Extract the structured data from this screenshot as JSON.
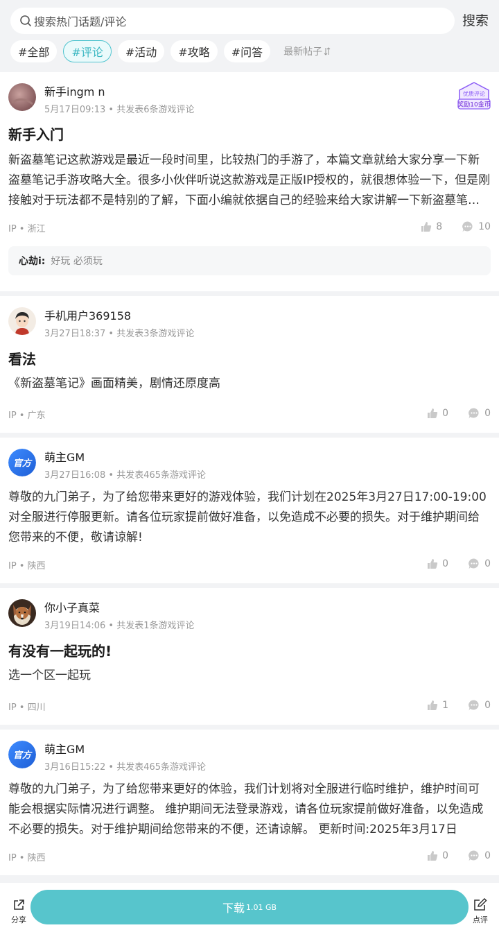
{
  "search": {
    "placeholder": "搜索热门话题/评论",
    "button": "搜索"
  },
  "tabs": [
    {
      "label": "#全部",
      "active": false
    },
    {
      "label": "#评论",
      "active": true
    },
    {
      "label": "#活动",
      "active": false
    },
    {
      "label": "#攻略",
      "active": false
    },
    {
      "label": "#问答",
      "active": false
    }
  ],
  "sort": {
    "label": "最新帖子"
  },
  "colors": {
    "accent": "#57c5cc",
    "tab_active": "#3ab7c2",
    "badge": "#8b5cf6",
    "official": "#2f6fe8"
  },
  "posts": [
    {
      "user": "新手ingm n",
      "avatar": "photo-avatar-pink",
      "date": "5月17日09:13",
      "count": "共发表6条游戏评论",
      "badge": {
        "line1": "优质评论",
        "line2": "奖励10金币"
      },
      "title": "新手入门",
      "body": "新盗墓笔记这款游戏是最近一段时间里，比较热门的手游了，本篇文章就给大家分享一下新盗墓笔记手游攻略大全。很多小伙伴听说这款游戏是正版IP授权的，就很想体验一下，但是刚接触对于玩法都不是特别的了解，下面小编就依据自己的经验来给大家讲解一下新盗墓笔记手游的玩法技巧。",
      "ip": "IP • 浙江",
      "likes": "8",
      "comments": "10",
      "reply": {
        "name": "心劫i:",
        "text": "好玩 必须玩"
      }
    },
    {
      "user": "手机用户369158",
      "avatar": "cartoon-avatar-boy",
      "date": "3月27日18:37",
      "count": "共发表3条游戏评论",
      "title": "看法",
      "body": "《新盗墓笔记》画面精美，剧情还原度高",
      "ip": "IP • 广东",
      "likes": "0",
      "comments": "0"
    },
    {
      "user": "萌主GM",
      "avatar": "official-avatar",
      "avatar_text": "官方",
      "date": "3月27日16:08",
      "count": "共发表465条游戏评论",
      "body": "尊敬的九门弟子，为了给您带来更好的游戏体验，我们计划在2025年3月27日17:00-19:00对全服进行停服更新。请各位玩家提前做好准备，以免造成不必要的损失。对于维护期间给您带来的不便，敬请谅解!",
      "ip": "IP • 陕西",
      "likes": "0",
      "comments": "0"
    },
    {
      "user": "你小子真菜",
      "avatar": "dog-photo-avatar",
      "date": "3月19日14:06",
      "count": "共发表1条游戏评论",
      "title": "有没有一起玩的!",
      "body": "选一个区一起玩",
      "ip": "IP • 四川",
      "likes": "1",
      "comments": "0"
    },
    {
      "user": "萌主GM",
      "avatar": "official-avatar",
      "avatar_text": "官方",
      "date": "3月16日15:22",
      "count": "共发表465条游戏评论",
      "body": "尊敬的九门弟子，为了给您带来更好的体验，我们计划将对全服进行临时维护，维护时间可能会根据实际情况进行调整。 维护期间无法登录游戏，请各位玩家提前做好准备，以免造成不必要的损失。对于维护期间给您带来的不便，还请谅解。 更新时间:2025年3月17日",
      "ip": "IP • 陕西",
      "likes": "0",
      "comments": "0"
    }
  ],
  "bottom_bar": {
    "share": "分享",
    "download": "下载",
    "download_size": "1.01 GB",
    "review": "点评"
  }
}
